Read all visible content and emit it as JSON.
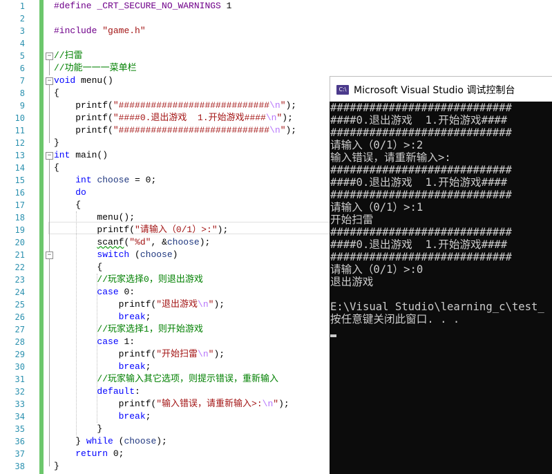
{
  "editor": {
    "line_numbers": [
      "1",
      "2",
      "3",
      "4",
      "5",
      "6",
      "7",
      "8",
      "9",
      "10",
      "11",
      "12",
      "13",
      "14",
      "15",
      "16",
      "17",
      "18",
      "19",
      "20",
      "21",
      "22",
      "23",
      "24",
      "25",
      "26",
      "27",
      "28",
      "29",
      "30",
      "31",
      "32",
      "33",
      "34",
      "35",
      "36",
      "37",
      "38"
    ],
    "lines": [
      {
        "t": "mac",
        "text": "#define _CRT_SECURE_NO_WARNINGS 1"
      },
      {
        "t": "blank",
        "text": ""
      },
      {
        "t": "mac",
        "text": "#include \"game.h\""
      },
      {
        "t": "blank",
        "text": ""
      },
      {
        "t": "cm",
        "text": "//扫雷"
      },
      {
        "t": "cm",
        "text": "//功能一一一菜单栏"
      },
      {
        "t": "code",
        "text": "void menu()"
      },
      {
        "t": "code",
        "text": "{"
      },
      {
        "t": "code",
        "text": "    printf(\"############################\\n\");"
      },
      {
        "t": "code",
        "text": "    printf(\"####0.退出游戏  1.开始游戏####\\n\");"
      },
      {
        "t": "code",
        "text": "    printf(\"############################\\n\");"
      },
      {
        "t": "code",
        "text": "}"
      },
      {
        "t": "code",
        "text": "int main()"
      },
      {
        "t": "code",
        "text": "{"
      },
      {
        "t": "code",
        "text": "    int choose = 0;"
      },
      {
        "t": "code",
        "text": "    do"
      },
      {
        "t": "code",
        "text": "    {"
      },
      {
        "t": "code",
        "text": "        menu();"
      },
      {
        "t": "code",
        "text": "        printf(\"请输入（0/1）>:\");"
      },
      {
        "t": "code",
        "text": "        scanf(\"%d\", &choose);"
      },
      {
        "t": "code",
        "text": "        switch (choose)"
      },
      {
        "t": "code",
        "text": "        {"
      },
      {
        "t": "cm",
        "text": "        //玩家选择0，则退出游戏"
      },
      {
        "t": "code",
        "text": "        case 0:"
      },
      {
        "t": "code",
        "text": "            printf(\"退出游戏\\n\");"
      },
      {
        "t": "code",
        "text": "            break;"
      },
      {
        "t": "cm",
        "text": "        //玩家选择1，则开始游戏"
      },
      {
        "t": "code",
        "text": "        case 1:"
      },
      {
        "t": "code",
        "text": "            printf(\"开始扫雷\\n\");"
      },
      {
        "t": "code",
        "text": "            break;"
      },
      {
        "t": "cm",
        "text": "        //玩家输入其它选项，则提示错误，重新输入"
      },
      {
        "t": "code",
        "text": "        default:"
      },
      {
        "t": "code",
        "text": "            printf(\"输入错误，请重新输入>:\\n\");"
      },
      {
        "t": "code",
        "text": "            break;"
      },
      {
        "t": "code",
        "text": "        }"
      },
      {
        "t": "code",
        "text": "    } while (choose);"
      },
      {
        "t": "code",
        "text": "    return 0;"
      },
      {
        "t": "code",
        "text": "}"
      }
    ]
  },
  "console": {
    "icon_text": "C:\\",
    "title": "Microsoft Visual Studio 调试控制台",
    "lines": [
      "############################",
      "####0.退出游戏  1.开始游戏####",
      "############################",
      "请输入（0/1）>:2",
      "输入错误，请重新输入>:",
      "############################",
      "####0.退出游戏  1.开始游戏####",
      "############################",
      "请输入（0/1）>:1",
      "开始扫雷",
      "############################",
      "####0.退出游戏  1.开始游戏####",
      "############################",
      "请输入（0/1）>:0",
      "退出游戏",
      "",
      "E:\\Visual Studio\\learning_c\\test_",
      "按任意键关闭此窗口. . ."
    ]
  },
  "colors": {
    "line_number": "#2b91af",
    "keyword": "#0000ff",
    "string": "#a31515",
    "comment": "#008000",
    "macro": "#6f008a",
    "change_bar": "#6cc76c",
    "console_bg": "#0c0c0c",
    "console_text": "#cccccc"
  }
}
